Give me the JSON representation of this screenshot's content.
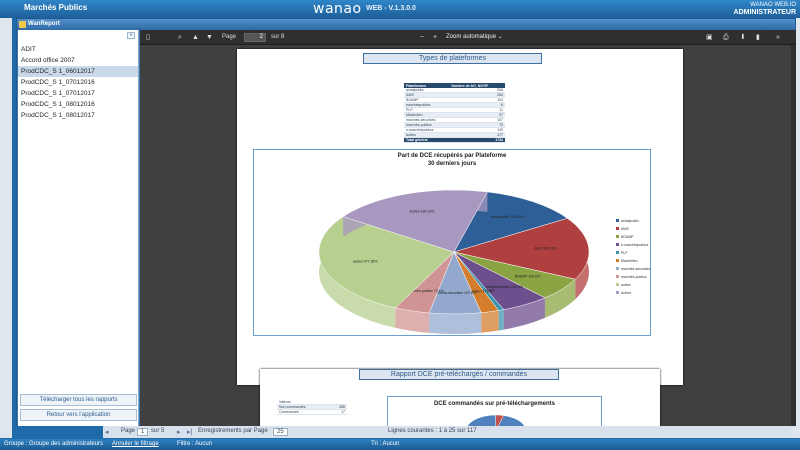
{
  "header": {
    "app_title": "Marchés Publics",
    "brand": "wanao",
    "version": "WEB - V.1.3.0.0",
    "user_line1": "WANAO WEB.IO",
    "user_role": "ADMINISTRATEUR"
  },
  "modal": {
    "title": "WanReport"
  },
  "report_list": {
    "items": [
      "ADIT",
      "Accord office 2007",
      "ProdCDC_S 1_06012017",
      "ProdCDC_S 1_07012016",
      "ProdCDC_S 1_07012017",
      "ProdCDC_S 1_08012016",
      "ProdCDC_S 1_08012017"
    ],
    "selected_index": 2,
    "download_all_label": "Télécharger tous les rapports",
    "back_label": "Retour vers l'application"
  },
  "viewer_toolbar": {
    "page_label": "Page",
    "page_value": "2",
    "page_total": "sur 8",
    "zoom_out": "−",
    "zoom_in": "+",
    "zoom_value": "Zoom automatique"
  },
  "page1": {
    "section_title": "Types de plateformes",
    "table_headers": [
      "Plateformes",
      "Nombre de AO_NOTIF"
    ],
    "table_rows": [
      [
        "achatpublic",
        "206"
      ],
      [
        "AWS",
        "284"
      ],
      [
        "BOAMP",
        "104"
      ],
      [
        "marchéspublics",
        "6"
      ],
      [
        "PLP",
        "11"
      ],
      [
        "Maximilien",
        "37"
      ],
      [
        "marchés-sécurisés",
        "107"
      ],
      [
        "marchés-publics",
        "73"
      ],
      [
        "e-marchéspublics",
        "100"
      ],
      [
        "autres",
        "477"
      ]
    ],
    "table_total": [
      "Total général",
      "1734"
    ]
  },
  "chart_data": [
    {
      "type": "pie",
      "title": "Part de DCE récupérés par Plateforme",
      "subtitle": "30 derniers jours",
      "categories": [
        "achatpublic",
        "AWS",
        "BOAMP",
        "e-marchéspublics",
        "PLP",
        "Maximilien",
        "marchés-sécurisés",
        "marchés-publics",
        "autres",
        "Autres"
      ],
      "values": [
        206,
        284,
        104,
        100,
        11,
        37,
        107,
        73,
        477,
        335
      ],
      "data_labels": [
        "achatpublic 206 12%",
        "AWS 284 16%",
        "BOAMP 104 6%",
        "e-marchéspublics 100 6%",
        "PLP 11 1%",
        "Maximilien 37 2%",
        "marchés-sécurisés 107 6%",
        "marchés-publics 73 4%",
        "autres 477 28%",
        "Autres 335 19%"
      ],
      "legend_position": "right",
      "colors": [
        "#2e5f96",
        "#b04040",
        "#8aa444",
        "#6d4f8d",
        "#3a96b0",
        "#d47d2c",
        "#92a9cd",
        "#d19494",
        "#b7cf8f",
        "#a898c0",
        "#8ec5d4"
      ]
    },
    {
      "type": "pie",
      "title": "DCE commandés sur pré-téléchargements",
      "categories": [
        "Valeurs",
        "Non commandés",
        "Commandés"
      ],
      "values": [
        0,
        388,
        17
      ],
      "colors": [
        "#c0504d",
        "#4f81bd"
      ]
    }
  ],
  "page2": {
    "section_title": "Rapport DCE pré-téléchargés / commandés",
    "table_rows": [
      [
        "Valeurs",
        ""
      ],
      [
        "Non commandés",
        "388"
      ],
      [
        "Commandés",
        "17"
      ]
    ]
  },
  "pager": {
    "page_label": "Page",
    "page_value": "1",
    "page_total": "sur 5",
    "per_page_label": "Enregistrements par Page",
    "per_page_value": "25",
    "range_text": "Lignes courantes : 1 à 25 sur 117"
  },
  "status_bar": {
    "group": "Groupe : Groupe des administrateurs",
    "cancel_filter": "Annuler le filtrage",
    "filter": "Filtre : Aucun",
    "sort": "Tri : Aucun"
  }
}
